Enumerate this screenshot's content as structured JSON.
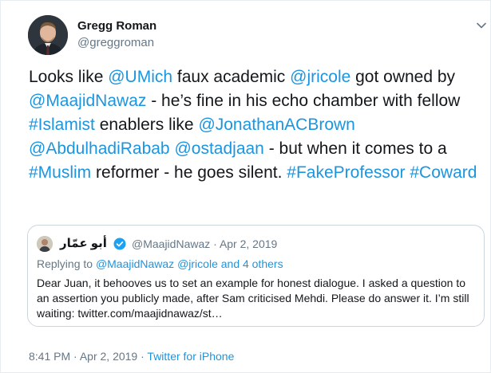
{
  "author": {
    "name": "Gregg Roman",
    "handle": "@greggroman"
  },
  "tweet": {
    "segments": [
      {
        "text": "Looks like ",
        "link": false
      },
      {
        "text": "@UMich",
        "link": true
      },
      {
        "text": " faux academic ",
        "link": false
      },
      {
        "text": "@jricole",
        "link": true
      },
      {
        "text": " got owned by ",
        "link": false
      },
      {
        "text": "@MaajidNawaz",
        "link": true
      },
      {
        "text": " - he’s fine in his echo chamber with fellow ",
        "link": false
      },
      {
        "text": "#Islamist",
        "link": true
      },
      {
        "text": " enablers like ",
        "link": false
      },
      {
        "text": "@JonathanACBrown",
        "link": true
      },
      {
        "text": " ",
        "link": false
      },
      {
        "text": "@AbdulhadiRabab",
        "link": true
      },
      {
        "text": " ",
        "link": false
      },
      {
        "text": "@ostadjaan",
        "link": true
      },
      {
        "text": " - but when it comes to a ",
        "link": false
      },
      {
        "text": "#Muslim",
        "link": true
      },
      {
        "text": " reformer - he goes silent. ",
        "link": false
      },
      {
        "text": "#FakeProfessor",
        "link": true
      },
      {
        "text": " ",
        "link": false
      },
      {
        "text": "#Coward",
        "link": true
      }
    ]
  },
  "quoted": {
    "name": "أبو عمّار",
    "handle": "@MaajidNawaz",
    "separator": "·",
    "date": "Apr 2, 2019",
    "replying_prefix": "Replying to ",
    "replying_users": "@MaajidNawaz @jricole",
    "replying_suffix": " and 4 others",
    "body": "Dear Juan, it behooves us to set an example for honest dialogue. I asked a question to an assertion you publicly made, after Sam criticised Mehdi. Please do answer it. I’m still waiting: twitter.com/maajidnawaz/st…"
  },
  "footer": {
    "time": "8:41 PM",
    "separator": "·",
    "date": "Apr 2, 2019",
    "source": "Twitter for iPhone"
  },
  "colors": {
    "link": "#1b95e0",
    "secondary": "#657786",
    "border": "#ccd6dd"
  },
  "icons": {
    "menu": "chevron-down-icon",
    "verified": "verified-badge-icon"
  }
}
